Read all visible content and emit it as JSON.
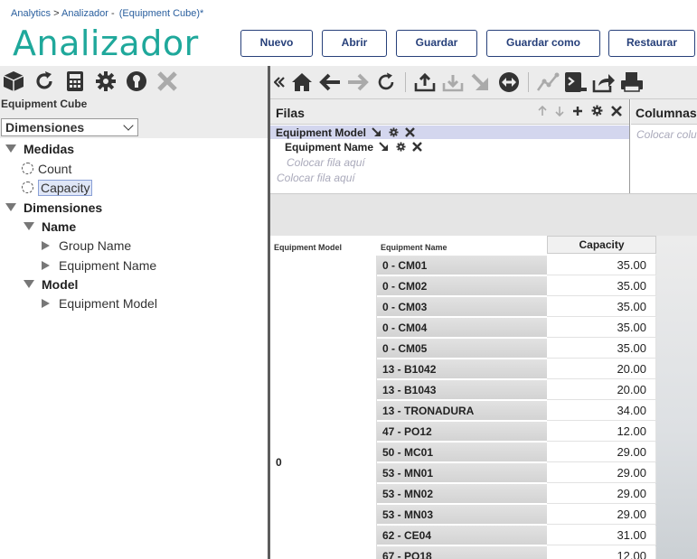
{
  "breadcrumb": {
    "root": "Analytics",
    "sep": ">",
    "current": "Analizador",
    "dash": "-",
    "cube": "(Equipment Cube)*"
  },
  "app_title": "Analizador",
  "header_buttons": [
    "Nuevo",
    "Abrir",
    "Guardar",
    "Guardar como",
    "Restaurar"
  ],
  "left_toolbar_icons": [
    "cube-icon",
    "refresh-icon",
    "calculator-icon",
    "gear-icon",
    "info-icon",
    "close-icon"
  ],
  "cube_name": "Equipment Cube",
  "view_select": {
    "value": "Dimensiones"
  },
  "tree": {
    "measures_label": "Medidas",
    "measures": [
      "Count",
      "Capacity"
    ],
    "selected_measure": "Capacity",
    "dimensions_label": "Dimensiones",
    "dimensions": [
      {
        "label": "Name",
        "children": [
          "Group Name",
          "Equipment Name"
        ]
      },
      {
        "label": "Model",
        "children": [
          "Equipment Model"
        ]
      }
    ]
  },
  "right_toolbar_icons": [
    "collapse-icon",
    "home-icon",
    "back-icon",
    "forward-icon",
    "refresh-icon",
    "upload-icon",
    "download-icon",
    "drill-down-icon",
    "swap-icon",
    "line-chart-icon",
    "terminal-icon",
    "share-icon",
    "print-icon"
  ],
  "rows_zone": {
    "title": "Filas",
    "fields": [
      "Equipment Model",
      "Equipment Name"
    ],
    "placeholder_nested": "Colocar fila aquí",
    "placeholder": "Colocar fila aquí"
  },
  "columns_zone": {
    "title": "Columnas",
    "placeholder": "Colocar colu"
  },
  "grid": {
    "header_model": "Equipment Model",
    "header_name": "Equipment Name",
    "header_measure": "Capacity",
    "model_value": "0",
    "rows": [
      {
        "name": "0 - CM01",
        "value": "35.00"
      },
      {
        "name": "0 - CM02",
        "value": "35.00"
      },
      {
        "name": "0 - CM03",
        "value": "35.00"
      },
      {
        "name": "0 - CM04",
        "value": "35.00"
      },
      {
        "name": "0 - CM05",
        "value": "35.00"
      },
      {
        "name": "13 - B1042",
        "value": "20.00"
      },
      {
        "name": "13 - B1043",
        "value": "20.00"
      },
      {
        "name": "13 - TRONADURA",
        "value": "34.00"
      },
      {
        "name": "47 - PO12",
        "value": "12.00"
      },
      {
        "name": "50 - MC01",
        "value": "29.00"
      },
      {
        "name": "53 - MN01",
        "value": "29.00"
      },
      {
        "name": "53 - MN02",
        "value": "29.00"
      },
      {
        "name": "53 - MN03",
        "value": "29.00"
      },
      {
        "name": "62 - CE04",
        "value": "31.00"
      },
      {
        "name": "67 - PO18",
        "value": "12.00"
      }
    ]
  },
  "colors": {
    "accent": "#1fa89b",
    "button_border": "#27407a",
    "link": "#2a5f9e"
  }
}
